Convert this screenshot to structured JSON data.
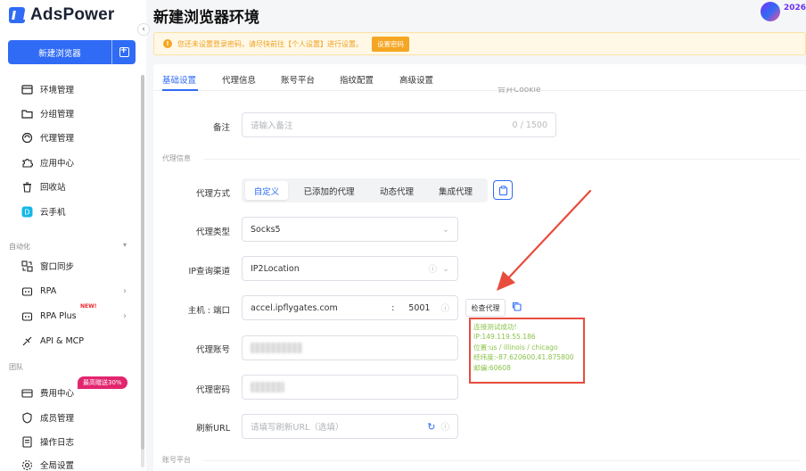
{
  "app": {
    "name": "AdsPower",
    "page_title": "新建浏览器环境",
    "badge_text": "2026"
  },
  "sidebar": {
    "new_button": "新建浏览器",
    "items": [
      {
        "label": "环境管理",
        "icon": "window-icon"
      },
      {
        "label": "分组管理",
        "icon": "folder-icon"
      },
      {
        "label": "代理管理",
        "icon": "proxy-icon"
      },
      {
        "label": "应用中心",
        "icon": "puzzle-icon"
      },
      {
        "label": "回收站",
        "icon": "trash-icon"
      },
      {
        "label": "云手机",
        "icon": "cloud-phone-icon"
      }
    ],
    "automation_label": "自动化",
    "automation_items": [
      {
        "label": "窗口同步"
      },
      {
        "label": "RPA"
      },
      {
        "label": "RPA Plus",
        "badge": "NEW!"
      },
      {
        "label": "API & MCP"
      }
    ],
    "team_label": "团队",
    "team_items": [
      {
        "label": "费用中心",
        "promo": "最高赠送30%"
      },
      {
        "label": "成员管理"
      },
      {
        "label": "操作日志"
      },
      {
        "label": "全局设置"
      }
    ]
  },
  "warning": {
    "text": "您还未设置登录密码，请尽快前往【个人设置】进行设置。",
    "button": "设置密码"
  },
  "tabs": [
    "基础设置",
    "代理信息",
    "账号平台",
    "指纹配置",
    "高级设置"
  ],
  "form": {
    "cut_text": "合并Cookie",
    "remark": {
      "label": "备注",
      "placeholder": "请输入备注",
      "counter": "0 / 1500"
    },
    "proxy_section_label": "代理信息",
    "proxy_mode": {
      "label": "代理方式",
      "options": [
        "自定义",
        "已添加的代理",
        "动态代理",
        "集成代理"
      ],
      "selected": "自定义"
    },
    "proxy_type": {
      "label": "代理类型",
      "value": "Socks5"
    },
    "ip_channel": {
      "label": "IP查询渠道",
      "value": "IP2Location"
    },
    "host": {
      "label": "主机 : 端口",
      "host": "accel.ipflygates.com",
      "sep": ":",
      "port": "5001",
      "check_button": "检查代理"
    },
    "result": [
      "连接测试成功!",
      "IP:149.119.55.186",
      "位置:us / illinois / chicago",
      "经纬度:-87.620600,41.875800",
      "邮编:60608"
    ],
    "account": {
      "label": "代理账号"
    },
    "password": {
      "label": "代理密码"
    },
    "refresh_url": {
      "label": "刷新URL",
      "placeholder": "请填写刷新URL（选填）"
    },
    "account_section_label": "账号平台"
  },
  "colors": {
    "primary": "#2f6bf5",
    "warning": "#f5a623",
    "success_text": "#8bc34a",
    "annotation": "#e84c3d"
  }
}
